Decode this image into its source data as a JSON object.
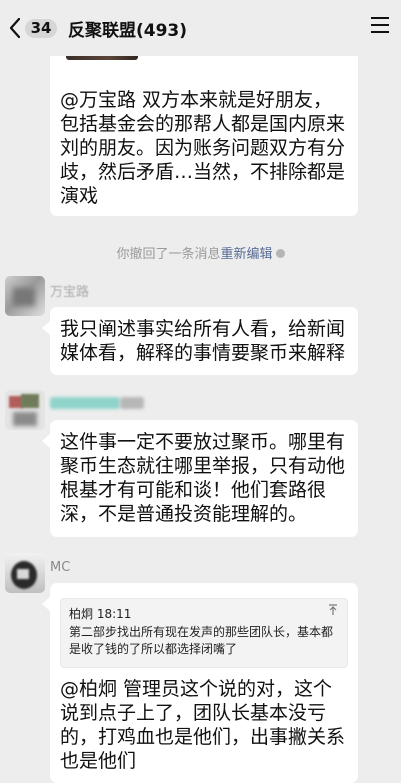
{
  "header": {
    "unread_count": "34",
    "title": "反聚联盟(493)"
  },
  "messages": {
    "m1": {
      "text": "@万宝路 双方本来就是好朋友，包括基金会的那帮人都是国内原来刘的朋友。因为账务问题双方有分歧，然后矛盾…当然，不排除都是演戏"
    },
    "system": {
      "notice": "你撤回了一条消息",
      "action": "重新编辑"
    },
    "m2": {
      "sender": "万宝路",
      "text": "我只阐述事实给所有人看，给新闻媒体看，解释的事情要聚币来解释"
    },
    "m3": {
      "text": "这件事一定不要放过聚币。哪里有聚币生态就往哪里举报，只有动他根基才有可能和谈！他们套路很深，不是普通投资能理解的。"
    },
    "m4": {
      "sender": "MC",
      "quote_author": "柏炯 18:11",
      "quote_text": "第二部步找出所有现在发声的那些团队长，基本都是收了钱的了所以都选择闭嘴了",
      "text": "@柏炯 管理员这个说的对，这个说到点子上了，团队长基本没亏的，打鸡血也是他们，出事撇关系也是他们"
    }
  },
  "colors": {
    "background": "#ededed",
    "bubble": "#ffffff",
    "link": "#576b95"
  },
  "icons": [
    "back-chevron-icon",
    "more-menu-icon",
    "close-circle-icon",
    "pin-icon"
  ]
}
